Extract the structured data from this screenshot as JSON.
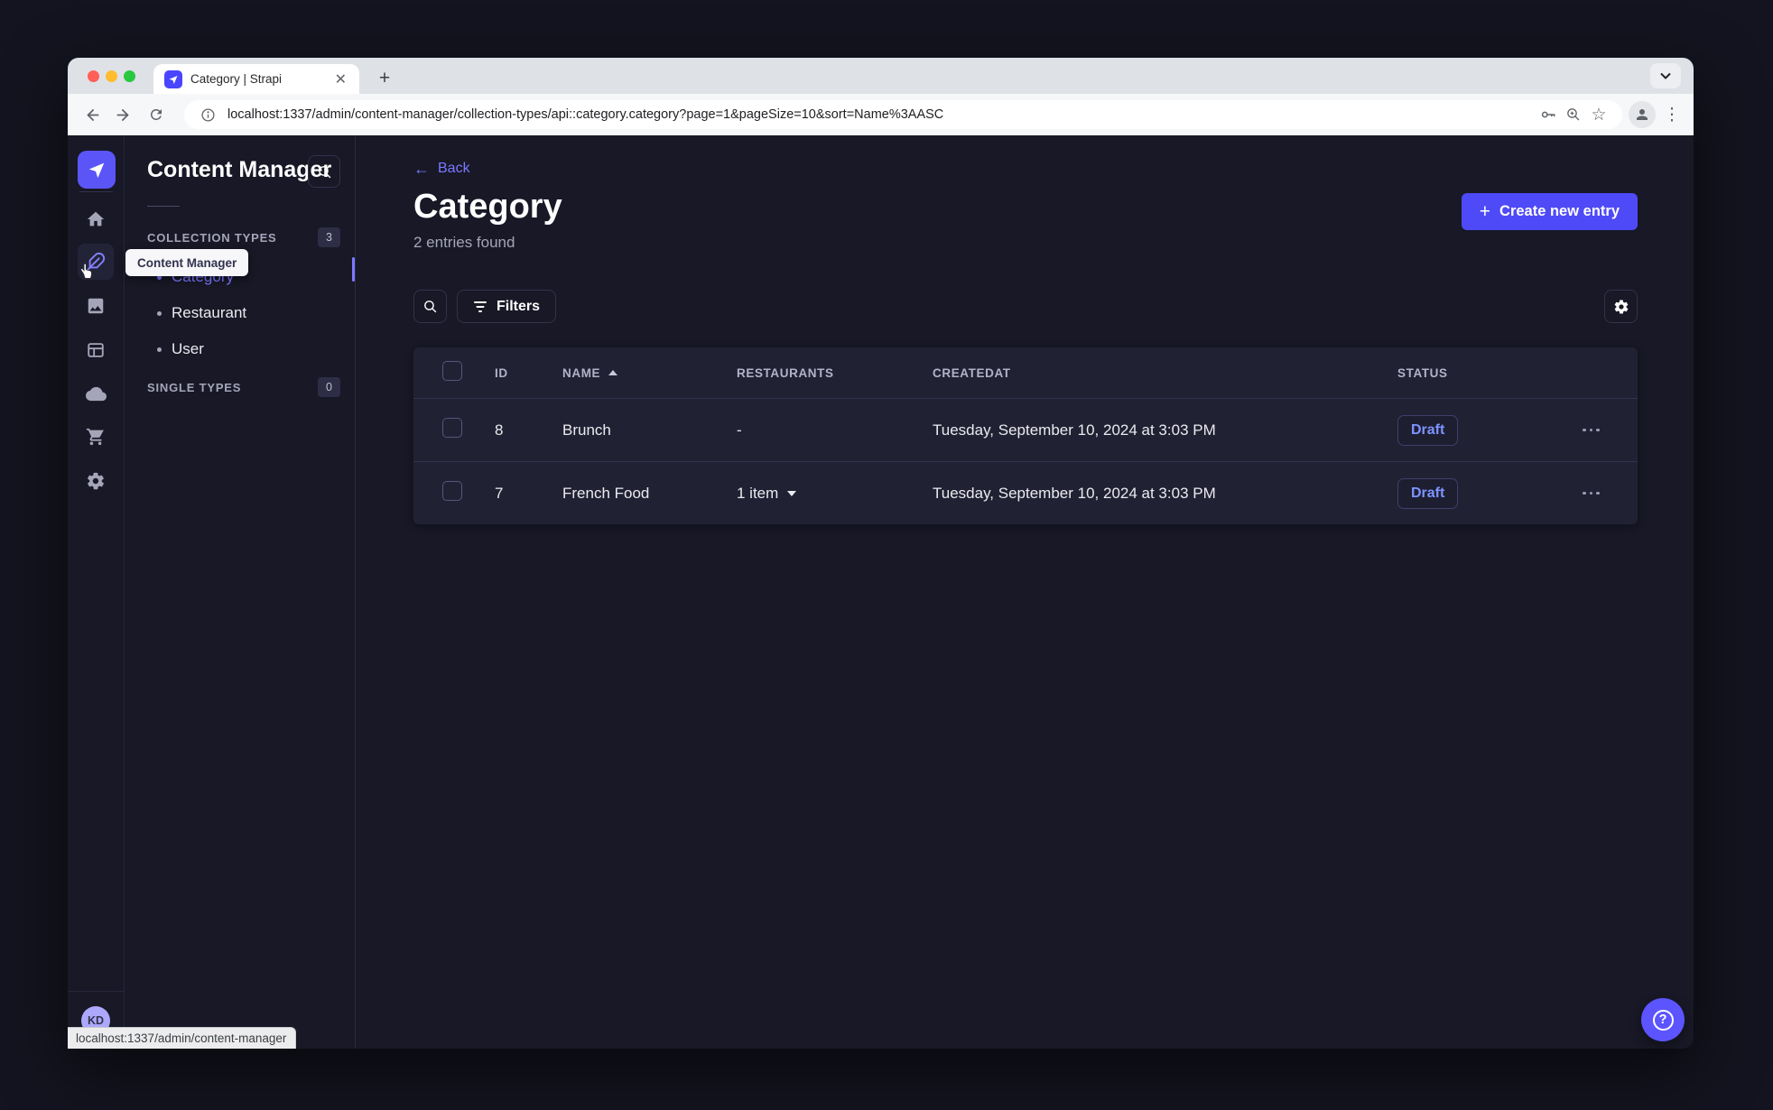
{
  "browser": {
    "tab_title": "Category | Strapi",
    "new_tab_label": "+",
    "url": "localhost:1337/admin/content-manager/collection-types/api::category.category?page=1&pageSize=10&sort=Name%3AASC",
    "status_bar_url": "localhost:1337/admin/content-manager"
  },
  "sidebar": {
    "tooltip": "Content Manager",
    "user_initials": "KD",
    "icons": [
      "strapi-logo",
      "home",
      "content-manager",
      "media-library",
      "content-type-builder",
      "cloud",
      "marketplace",
      "settings"
    ]
  },
  "subnav": {
    "title": "Content Manager",
    "sections": [
      {
        "label": "COLLECTION TYPES",
        "badge": "3"
      },
      {
        "label": "SINGLE TYPES",
        "badge": "0"
      }
    ],
    "items": [
      {
        "label": "Category",
        "active": true
      },
      {
        "label": "Restaurant",
        "active": false
      },
      {
        "label": "User",
        "active": false
      }
    ]
  },
  "main": {
    "back_label": "Back",
    "title": "Category",
    "entries_count": "2 entries found",
    "create_button_label": "Create new entry",
    "filters_button_label": "Filters",
    "table": {
      "headers": {
        "id": "ID",
        "name": "NAME",
        "restaurants": "RESTAURANTS",
        "createdat": "CREATEDAT",
        "status": "STATUS"
      },
      "rows": [
        {
          "id": "8",
          "name": "Brunch",
          "restaurants": "-",
          "has_dropdown": false,
          "createdat": "Tuesday, September 10, 2024 at 3:03 PM",
          "status": "Draft"
        },
        {
          "id": "7",
          "name": "French Food",
          "restaurants": "1 item",
          "has_dropdown": true,
          "createdat": "Tuesday, September 10, 2024 at 3:03 PM",
          "status": "Draft"
        }
      ]
    }
  },
  "colors": {
    "primary": "#4945ff",
    "primary_bright": "#5c55ff",
    "accent_text": "#7b79ff",
    "page_bg": "#181826",
    "card_bg": "#212134",
    "border": "#32324d",
    "muted_text": "#a5a5ba",
    "status_draft_text": "#7e94ff"
  }
}
